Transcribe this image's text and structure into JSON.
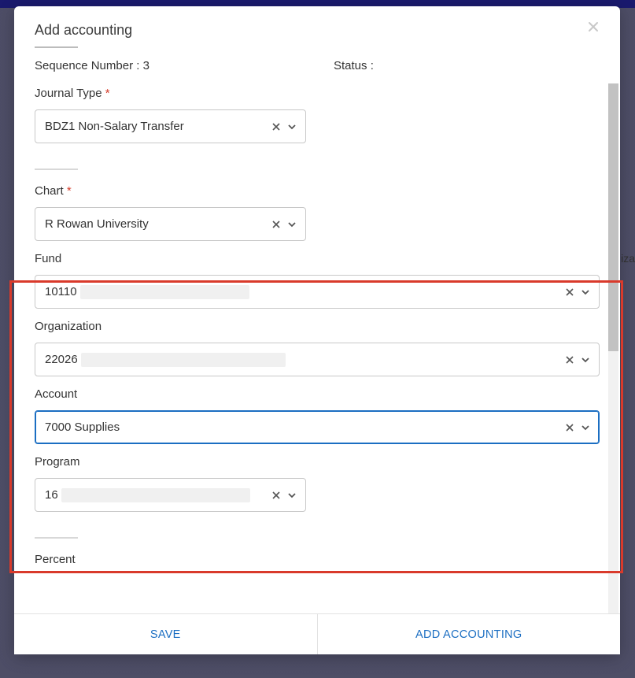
{
  "backdrop": {
    "partial_text": "iza"
  },
  "modal": {
    "title": "Add accounting",
    "meta": {
      "sequence_label": "Sequence Number :",
      "sequence_value": "3",
      "status_label": "Status :",
      "status_value": ""
    },
    "fields": {
      "journal_type": {
        "label": "Journal Type",
        "required": true,
        "value": "BDZ1 Non-Salary Transfer"
      },
      "chart": {
        "label": "Chart",
        "required": true,
        "value": "R Rowan University"
      },
      "fund": {
        "label": "Fund",
        "value_visible": "10110"
      },
      "organization": {
        "label": "Organization",
        "value_visible": "22026"
      },
      "account": {
        "label": "Account",
        "value": "7000 Supplies"
      },
      "program": {
        "label": "Program",
        "value_visible": "16"
      },
      "percent": {
        "label": "Percent"
      }
    },
    "footer": {
      "save_label": "SAVE",
      "add_label": "ADD ACCOUNTING"
    }
  },
  "icons": {
    "clear": "clear-icon",
    "chevron": "chevron-down-icon",
    "close": "close-icon"
  }
}
